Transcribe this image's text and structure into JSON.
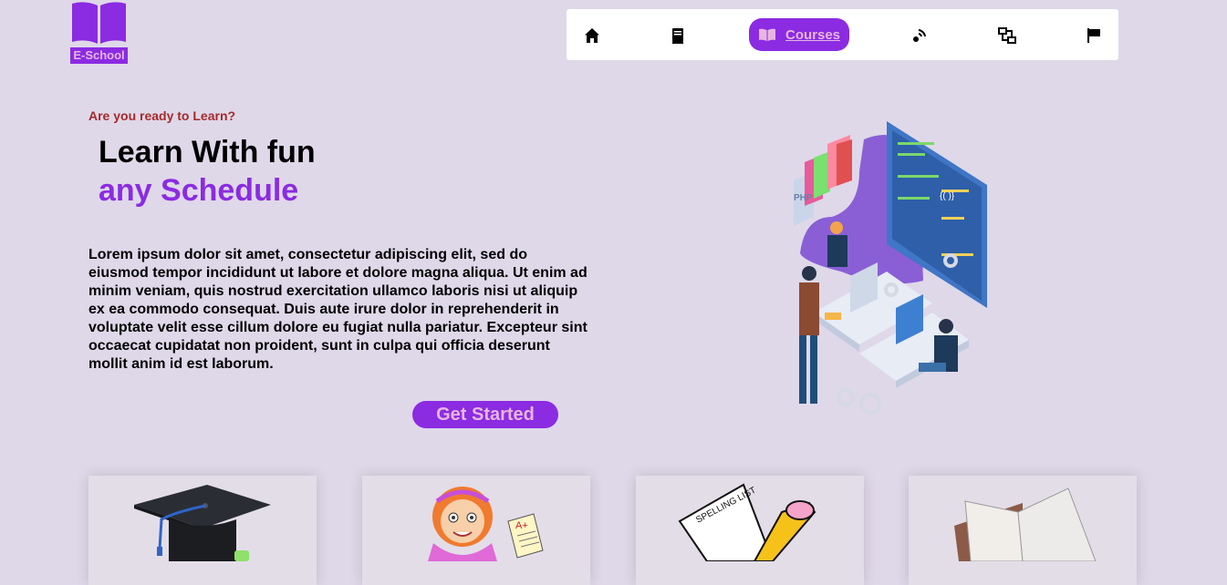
{
  "brand": {
    "name": "E-School",
    "accent": "#8b2be2",
    "accent_text": "#e6b6e0"
  },
  "nav": {
    "items": [
      {
        "icon": "home-icon",
        "label": ""
      },
      {
        "icon": "book-icon",
        "label": ""
      },
      {
        "icon": "open-book-icon",
        "label": "Courses",
        "active": true
      },
      {
        "icon": "connect-icon",
        "label": ""
      },
      {
        "icon": "diagram-icon",
        "label": ""
      },
      {
        "icon": "flag-icon",
        "label": ""
      }
    ]
  },
  "hero": {
    "eyebrow": "Are you ready to Learn?",
    "title_line1": "Learn With fun",
    "title_line2": "any Schedule",
    "paragraph": "Lorem ipsum dolor sit amet, consectetur adipiscing elit, sed do eiusmod tempor incididunt ut labore et dolore magna aliqua. Ut enim ad minim veniam, quis nostrud exercitation ullamco laboris nisi ut aliquip ex ea commodo consequat. Duis aute irure dolor in reprehenderit in voluptate velit esse cillum dolore eu fugiat nulla pariatur. Excepteur sint occaecat cupidatat non proident, sunt in culpa qui officia deserunt mollit anim id est laborum.",
    "cta_label": "Get Started"
  },
  "illustration": {
    "book_label": "PHP"
  },
  "cards": [
    {
      "icon": "graduation-cap-icon"
    },
    {
      "icon": "student-icon",
      "grade": "A+"
    },
    {
      "icon": "spelling-list-icon",
      "text": "SPELLING LIST"
    },
    {
      "icon": "open-book-icon"
    }
  ]
}
